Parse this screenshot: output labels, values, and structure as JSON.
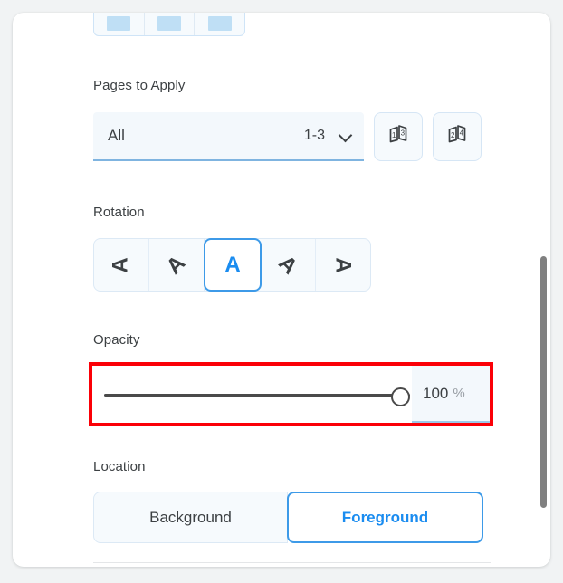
{
  "panel": {
    "top_clipped_group": {
      "name": "color-swatch-group",
      "segments": [
        "swatch-1",
        "swatch-2",
        "swatch-3"
      ]
    },
    "sections": {
      "pages_to_apply": {
        "label": "Pages to Apply",
        "select": {
          "value": "All",
          "range": "1-3",
          "chevron": "chevron-down-icon"
        },
        "buttons": [
          {
            "name": "odd-pages-button",
            "icon": "pages-odd-icon",
            "page_labels": [
              "1",
              "3"
            ]
          },
          {
            "name": "even-pages-button",
            "icon": "pages-even-icon",
            "page_labels": [
              "2",
              "4"
            ]
          }
        ]
      },
      "rotation": {
        "label": "Rotation",
        "options": [
          {
            "glyph": "A",
            "angle": -90,
            "selected": false
          },
          {
            "glyph": "A",
            "angle": -45,
            "selected": false
          },
          {
            "glyph": "A",
            "angle": 0,
            "selected": true
          },
          {
            "glyph": "A",
            "angle": 45,
            "selected": false
          },
          {
            "glyph": "A",
            "angle": 90,
            "selected": false
          }
        ]
      },
      "opacity": {
        "label": "Opacity",
        "slider_value": 100,
        "slider_min": 0,
        "slider_max": 100,
        "field_value": "100",
        "field_unit": "%",
        "highlight_color": "#fb0007"
      },
      "location": {
        "label": "Location",
        "options": [
          {
            "label": "Background",
            "selected": false
          },
          {
            "label": "Foreground",
            "selected": true
          }
        ]
      }
    }
  },
  "colors": {
    "accent": "#1a8cf0",
    "accent_border": "#3d9ae8",
    "field_bg": "#f3f8fc",
    "text": "#3c4043",
    "muted_text": "#9aa0a6",
    "highlight": "#fb0007",
    "page_bg": "#f1f3f4"
  }
}
